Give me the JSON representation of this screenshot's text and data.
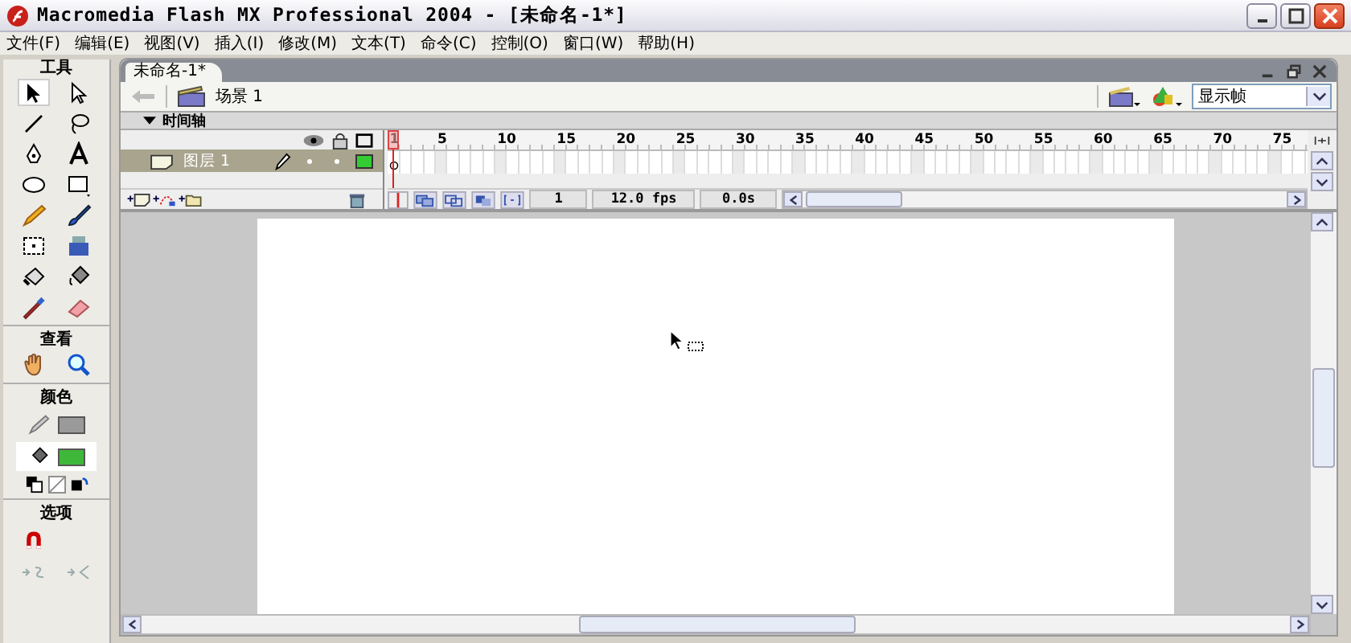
{
  "window": {
    "title": "Macromedia Flash MX Professional 2004 - [未命名-1*]"
  },
  "menu": [
    "文件(F)",
    "编辑(E)",
    "视图(V)",
    "插入(I)",
    "修改(M)",
    "文本(T)",
    "命令(C)",
    "控制(O)",
    "窗口(W)",
    "帮助(H)"
  ],
  "toolbox": {
    "title": "工具",
    "tools": [
      {
        "kind": "arrow",
        "selected": true
      },
      {
        "kind": "subselect",
        "selected": false
      },
      {
        "kind": "line",
        "selected": false
      },
      {
        "kind": "lasso",
        "selected": false
      },
      {
        "kind": "pen",
        "selected": false
      },
      {
        "kind": "text",
        "selected": false
      },
      {
        "kind": "oval",
        "selected": false
      },
      {
        "kind": "rect",
        "selected": false
      },
      {
        "kind": "pencil",
        "selected": false
      },
      {
        "kind": "brush",
        "selected": false
      },
      {
        "kind": "transform",
        "selected": false
      },
      {
        "kind": "filltransform",
        "selected": false
      },
      {
        "kind": "ink",
        "selected": false
      },
      {
        "kind": "bucket",
        "selected": false
      },
      {
        "kind": "dropper",
        "selected": false
      },
      {
        "kind": "eraser",
        "selected": false
      }
    ],
    "view_title": "查看",
    "view_tools": [
      {
        "kind": "hand",
        "selected": false
      },
      {
        "kind": "zoom",
        "selected": false
      }
    ],
    "colors_title": "颜色",
    "swatches": [
      {
        "kind": "stroke",
        "color": "#9a9a9a"
      },
      {
        "kind": "fill",
        "color": "#3fb83a"
      }
    ],
    "options_title": "选项"
  },
  "document": {
    "tab": "未命名-1*",
    "scene": "场景 1",
    "zoom": "显示帧"
  },
  "timeline": {
    "title": "时间轴",
    "expanded": true,
    "ruler": [
      "1",
      "5",
      "10",
      "15",
      "20",
      "25",
      "30",
      "35",
      "40",
      "45",
      "50",
      "55",
      "60",
      "65",
      "70",
      "75"
    ],
    "layers": [
      {
        "name": "图层 1",
        "selected": true,
        "color": "#33cc33"
      }
    ],
    "current_frame": "1",
    "frame_rate": "12.0 fps",
    "elapsed": "0.0s"
  }
}
